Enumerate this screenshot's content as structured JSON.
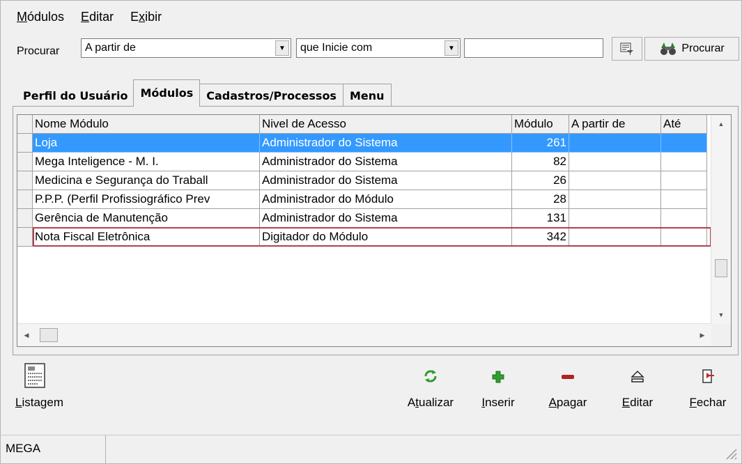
{
  "menubar": [
    {
      "pre": "",
      "key": "M",
      "post": "ódulos"
    },
    {
      "pre": "",
      "key": "E",
      "post": "ditar"
    },
    {
      "pre": "E",
      "key": "x",
      "post": "ibir"
    }
  ],
  "search": {
    "label": "Procurar",
    "field_value": "A partir de",
    "mode_value": "que Inicie com",
    "text_value": "",
    "button_label": "Procurar"
  },
  "tabs": [
    "Perfil do Usuário",
    "Módulos",
    "Cadastros/Processos",
    "Menu"
  ],
  "grid": {
    "columns": [
      "Nome Módulo",
      "Nivel de Acesso",
      "Módulo",
      "A partir de",
      "Até"
    ],
    "rows": [
      {
        "nome": "Loja",
        "nivel": "Administrador do Sistema",
        "modulo": "261",
        "apartir": "",
        "ate": ""
      },
      {
        "nome": "Mega Inteligence - M. I.",
        "nivel": "Administrador do Sistema",
        "modulo": "82",
        "apartir": "",
        "ate": ""
      },
      {
        "nome": "Medicina e Segurança do Traball",
        "nivel": "Administrador do Sistema",
        "modulo": "26",
        "apartir": "",
        "ate": ""
      },
      {
        "nome": "P.P.P. (Perfil Profissiográfico Prev",
        "nivel": "Administrador do Módulo",
        "modulo": "28",
        "apartir": "",
        "ate": ""
      },
      {
        "nome": "Gerência de Manutenção",
        "nivel": "Administrador do Sistema",
        "modulo": "131",
        "apartir": "",
        "ate": ""
      },
      {
        "nome": "Nota Fiscal Eletrônica",
        "nivel": "Digitador do Módulo",
        "modulo": "342",
        "apartir": "",
        "ate": ""
      }
    ]
  },
  "actions": {
    "listagem": {
      "key": "L",
      "rest": "istagem"
    },
    "atualizar": {
      "pre": "A",
      "key": "t",
      "rest": "ualizar"
    },
    "inserir": {
      "key": "I",
      "rest": "nserir"
    },
    "apagar": {
      "key": "A",
      "rest": "pagar"
    },
    "editar": {
      "key": "E",
      "rest": "ditar"
    },
    "fechar": {
      "key": "F",
      "rest": "echar"
    }
  },
  "status": {
    "panel1": "MEGA",
    "panel2": ""
  },
  "colors": {
    "selection": "#3399ff",
    "row_outline": "#b04050",
    "refresh_icon": "#2e9a2e",
    "insert_icon": "#2f9e2f",
    "delete_icon": "#b22222"
  }
}
